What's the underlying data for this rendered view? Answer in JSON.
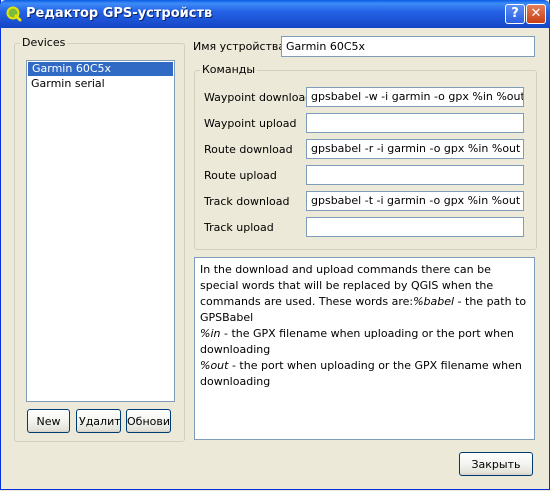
{
  "window": {
    "title": "Редактор GPS-устройств",
    "help_button": "?",
    "close_button": "✕"
  },
  "devices": {
    "group_label": "Devices",
    "items": [
      {
        "label": "Garmin 60C5x",
        "selected": true
      },
      {
        "label": "Garmin serial",
        "selected": false
      }
    ],
    "buttons": {
      "new": "New",
      "delete": "Удалить",
      "update": "Обновить"
    }
  },
  "device_name": {
    "label": "Имя устройства",
    "value": "Garmin 60C5x"
  },
  "commands": {
    "group_label": "Команды",
    "rows": [
      {
        "label": "Waypoint download",
        "value": "gpsbabel -w -i garmin -o gpx %in %out"
      },
      {
        "label": "Waypoint upload",
        "value": ""
      },
      {
        "label": "Route download",
        "value": "gpsbabel -r -i garmin -o gpx %in %out"
      },
      {
        "label": "Route upload",
        "value": ""
      },
      {
        "label": "Track download",
        "value": "gpsbabel -t -i garmin -o gpx %in %out"
      },
      {
        "label": "Track upload",
        "value": ""
      }
    ]
  },
  "help": {
    "intro": "In the download and upload commands there can be special words that will be replaced by QGIS when the commands are used. These words are:",
    "babel_word": "%babel",
    "babel_desc": " - the path to GPSBabel",
    "in_word": "%in",
    "in_desc": " - the GPX filename when uploading or the port when downloading",
    "out_word": "%out",
    "out_desc": " - the port when uploading or the GPX filename when downloading"
  },
  "footer": {
    "close_label": "Закрыть"
  },
  "colors": {
    "titlebar": "#2563e6",
    "selection": "#316ac5",
    "dialog_bg": "#ece9d8"
  }
}
